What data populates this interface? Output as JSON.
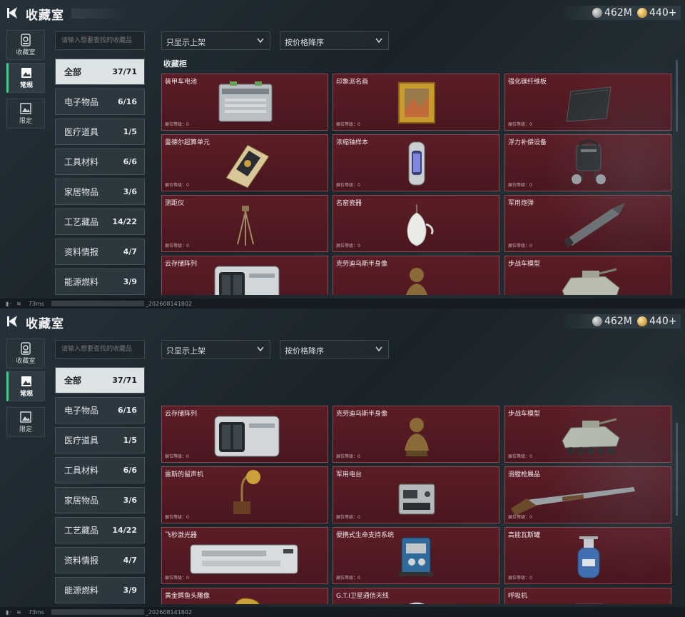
{
  "header": {
    "title": "收藏室"
  },
  "currency": {
    "silver": "462M",
    "gold": "440+"
  },
  "left_nav": [
    {
      "label": "收藏室",
      "icon": "archive-icon"
    },
    {
      "label": "常规",
      "icon": "image-icon",
      "active": true
    },
    {
      "label": "限定",
      "icon": "image-frame-icon"
    }
  ],
  "search": {
    "placeholder": "请输入想要查找的收藏品"
  },
  "filters": {
    "shelf_filter": "只显示上架",
    "sort": "按价格降序"
  },
  "categories": [
    {
      "label": "全部",
      "count": "37/71",
      "active": true
    },
    {
      "label": "电子物品",
      "count": "6/16"
    },
    {
      "label": "医疗道具",
      "count": "1/5"
    },
    {
      "label": "工具材料",
      "count": "6/6"
    },
    {
      "label": "家居物品",
      "count": "3/6"
    },
    {
      "label": "工艺藏品",
      "count": "14/22"
    },
    {
      "label": "资料情报",
      "count": "4/7"
    },
    {
      "label": "能源燃料",
      "count": "3/9"
    }
  ],
  "section_title": "收藏柜",
  "level_text": "展位等级：0",
  "items_top": [
    {
      "name": "装甲车电池",
      "icon": "battery-icon"
    },
    {
      "name": "印象派名画",
      "icon": "painting-icon"
    },
    {
      "name": "强化碳纤维板",
      "icon": "carbon-plate-icon"
    },
    {
      "name": "曼德尔超算单元",
      "icon": "computing-unit-icon"
    },
    {
      "name": "浓缩铀样本",
      "icon": "uranium-canister-icon"
    },
    {
      "name": "浮力补偿设备",
      "icon": "buoyancy-device-icon"
    },
    {
      "name": "测距仪",
      "icon": "tripod-icon"
    },
    {
      "name": "名窑瓷器",
      "icon": "porcelain-vase-icon"
    },
    {
      "name": "军用炮弹",
      "icon": "artillery-shell-icon"
    },
    {
      "name": "云存储阵列",
      "icon": "storage-array-icon"
    },
    {
      "name": "克劳迪乌斯半身像",
      "icon": "bust-icon"
    },
    {
      "name": "步战车模型",
      "icon": "armored-vehicle-icon"
    }
  ],
  "items_bottom": [
    {
      "name": "云存储阵列",
      "icon": "storage-array-icon"
    },
    {
      "name": "克劳迪乌斯半身像",
      "icon": "bust-icon"
    },
    {
      "name": "步战车模型",
      "icon": "armored-vehicle-icon"
    },
    {
      "name": "雷斯的留声机",
      "icon": "gramophone-icon"
    },
    {
      "name": "军用电台",
      "icon": "radio-icon"
    },
    {
      "name": "滑膛枪展品",
      "icon": "musket-icon"
    },
    {
      "name": "飞秒激光器",
      "icon": "laser-device-icon"
    },
    {
      "name": "便携式生命支持系统",
      "icon": "life-support-icon"
    },
    {
      "name": "高能瓦斯罐",
      "icon": "gas-tank-icon"
    },
    {
      "name": "黄金鳄鱼头雕像",
      "icon": "crocodile-statue-icon"
    },
    {
      "name": "G.T.I卫星通信天线",
      "icon": "satellite-dish-icon"
    },
    {
      "name": "呼吸机",
      "icon": "ventilator-icon"
    }
  ],
  "status": {
    "latency": "73ms",
    "version": "_202608141802"
  },
  "colors": {
    "card_bg": "#4f1920",
    "card_border": "#8a4a52",
    "accent_green": "#39d38a",
    "active_category_bg": "#dde2e5"
  }
}
